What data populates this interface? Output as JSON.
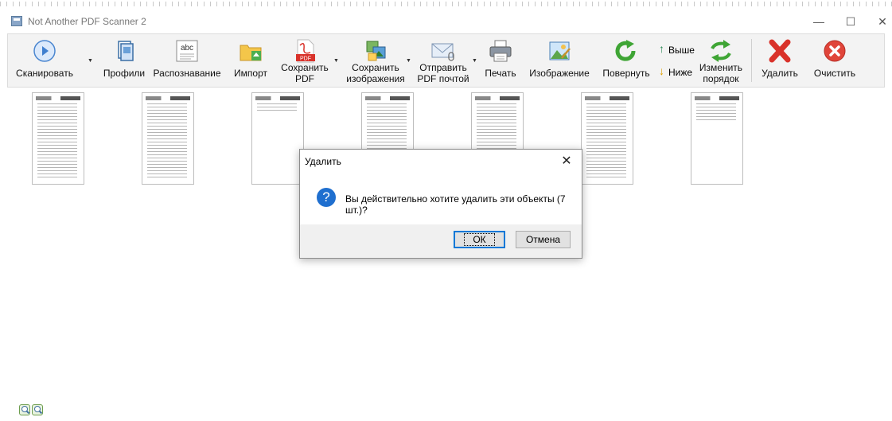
{
  "window": {
    "title": "Not Another PDF Scanner 2",
    "minimize_glyph": "—",
    "maximize_glyph": "☐",
    "close_glyph": "✕"
  },
  "toolbar": {
    "scan": "Сканировать",
    "profiles": "Профили",
    "ocr": "Распознавание",
    "ocr_icon_text": "abc",
    "import": "Импорт",
    "save_pdf_1": "Сохранить",
    "save_pdf_2": "PDF",
    "pdf_icon_text": "PDF",
    "save_images_1": "Сохранить",
    "save_images_2": "изображения",
    "email_pdf_1": "Отправить",
    "email_pdf_2": "PDF почтой",
    "print": "Печать",
    "image": "Изображение",
    "rotate": "Повернуть",
    "move_up": "Выше",
    "move_down": "Ниже",
    "reorder_1": "Изменить",
    "reorder_2": "порядок",
    "delete": "Удалить",
    "clear": "Очистить",
    "dropdown_glyph": "▼"
  },
  "thumbnails": [
    "page-1",
    "page-2",
    "page-3",
    "page-4",
    "page-5",
    "page-6",
    "page-7"
  ],
  "dialog": {
    "title": "Удалить",
    "close_glyph": "✕",
    "icon_glyph": "?",
    "message": "Вы действительно хотите удалить эти объекты (7 шт.)?",
    "ok": "ОК",
    "cancel": "Отмена"
  },
  "colors": {
    "accent": "#0078d7",
    "delete_red": "#d9322a",
    "rotate_green": "#3fa535",
    "question_blue": "#1f6fcf"
  },
  "icons": {
    "scan": "scan-icon",
    "profiles": "profiles-icon",
    "ocr": "ocr-icon",
    "import": "import-folder-icon",
    "save_pdf": "pdf-icon",
    "save_images": "images-icon",
    "email": "email-icon",
    "print": "printer-icon",
    "image": "image-icon",
    "rotate": "rotate-icon",
    "up": "arrow-up-icon",
    "down": "arrow-down-icon",
    "reorder": "reorder-icon",
    "delete": "delete-x-icon",
    "clear": "clear-icon",
    "zoom_out": "zoom-out-icon",
    "zoom_in": "zoom-in-icon"
  }
}
